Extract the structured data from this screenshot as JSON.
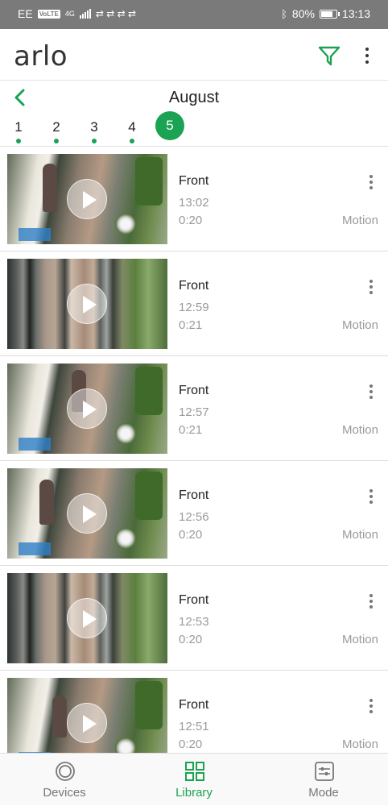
{
  "status_bar": {
    "carrier": "EE",
    "volte": "VoLTE",
    "network": "4G",
    "battery": "80%",
    "time": "13:13",
    "battery_level": 0.8
  },
  "app_bar": {
    "logo": "arlo",
    "filter_icon": "filter-funnel-icon",
    "more_icon": "more-vertical-icon"
  },
  "calendar": {
    "month": "August",
    "back_icon": "chevron-left-icon",
    "days": [
      {
        "label": "1",
        "selected": false,
        "has_recordings": true
      },
      {
        "label": "2",
        "selected": false,
        "has_recordings": true
      },
      {
        "label": "3",
        "selected": false,
        "has_recordings": true
      },
      {
        "label": "4",
        "selected": false,
        "has_recordings": true
      },
      {
        "label": "5",
        "selected": true,
        "has_recordings": true
      }
    ]
  },
  "recordings": [
    {
      "camera": "Front",
      "time": "13:02",
      "duration": "0:20",
      "trigger": "Motion"
    },
    {
      "camera": "Front",
      "time": "12:59",
      "duration": "0:21",
      "trigger": "Motion"
    },
    {
      "camera": "Front",
      "time": "12:57",
      "duration": "0:21",
      "trigger": "Motion"
    },
    {
      "camera": "Front",
      "time": "12:56",
      "duration": "0:20",
      "trigger": "Motion"
    },
    {
      "camera": "Front",
      "time": "12:53",
      "duration": "0:20",
      "trigger": "Motion"
    },
    {
      "camera": "Front",
      "time": "12:51",
      "duration": "0:20",
      "trigger": "Motion"
    }
  ],
  "tab_bar": {
    "tabs": [
      {
        "label": "Devices",
        "icon": "devices-icon",
        "active": false
      },
      {
        "label": "Library",
        "icon": "library-grid-icon",
        "active": true
      },
      {
        "label": "Mode",
        "icon": "mode-sliders-icon",
        "active": false
      }
    ]
  },
  "colors": {
    "accent": "#1aa352",
    "status_bar": "#7a7a7a",
    "muted_text": "#9a9a9a"
  }
}
